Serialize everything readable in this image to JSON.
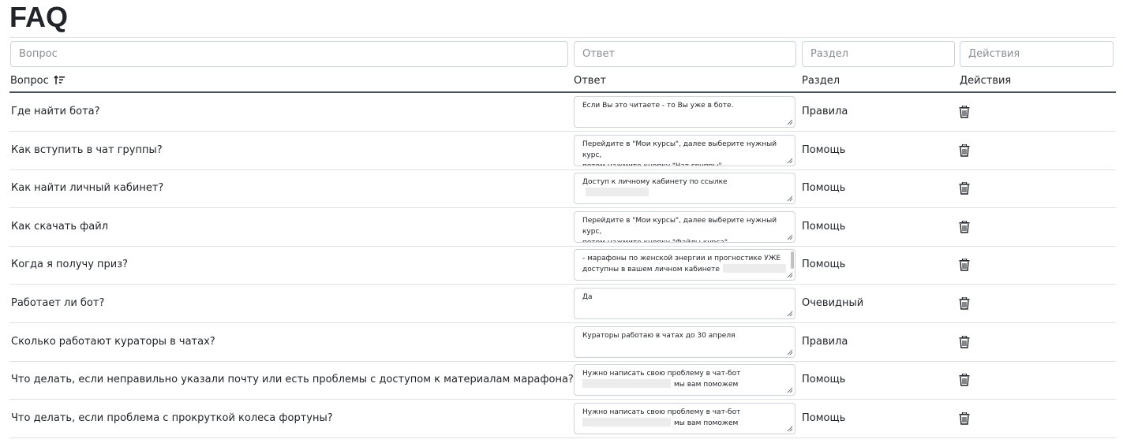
{
  "page": {
    "title": "FAQ"
  },
  "filters": {
    "question_placeholder": "Вопрос",
    "answer_placeholder": "Ответ",
    "section_placeholder": "Раздел",
    "actions_placeholder": "Действия"
  },
  "table": {
    "headers": {
      "question": "Вопрос",
      "answer": "Ответ",
      "section": "Раздел",
      "actions": "Действия"
    },
    "sort": {
      "column": "question",
      "direction": "ascending"
    },
    "rows": [
      {
        "question": "Где найти бота?",
        "answer_lines": [
          "Если Вы это читаете - то Вы уже в боте."
        ],
        "section": "Правила"
      },
      {
        "question": "Как вступить в чат группы?",
        "answer_lines": [
          "Перейдите в \"Мои курсы\", далее выберите нужный курс,",
          "потом нажмите кнопку \"Чат группы\""
        ],
        "section": "Помощь"
      },
      {
        "question": "Как найти личный кабинет?",
        "answer_lines": [
          "Доступ к личному кабинету по ссылке"
        ],
        "section": "Помощь"
      },
      {
        "question": "Как скачать файл",
        "answer_lines": [
          "Перейдите в \"Мои курсы\", далее выберите нужный курс,",
          "потом нажмите кнопку \"Файлы курса\""
        ],
        "section": "Помощь"
      },
      {
        "question": "Когда я получу приз?",
        "answer_lines": [
          "- марафоны по женской энергии и прогностике УЖЕ",
          "доступны в вашем личном кабинете"
        ],
        "section": "Помощь"
      },
      {
        "question": "Работает ли бот?",
        "answer_lines": [
          "Да"
        ],
        "section": "Очевидный"
      },
      {
        "question": "Сколько работают кураторы в чатах?",
        "answer_lines": [
          "Кураторы работаю в чатах до 30 апреля"
        ],
        "section": "Правила"
      },
      {
        "question": "Что делать, если неправильно указали почту или есть проблемы с доступом к материалам марафона?",
        "answer_lines": [
          "Нужно написать свою проблему в чат-бот",
          "мы вам поможем"
        ],
        "section": "Помощь"
      },
      {
        "question": "Что делать, если проблема с прокруткой колеса фортуны?",
        "answer_lines": [
          "Нужно написать свою проблему в чат-бот",
          "мы вам поможем"
        ],
        "section": "Помощь"
      }
    ]
  },
  "icons": {
    "sort": "sort-ascending-icon",
    "delete": "trash-icon",
    "resize": "resize-grip-icon"
  }
}
